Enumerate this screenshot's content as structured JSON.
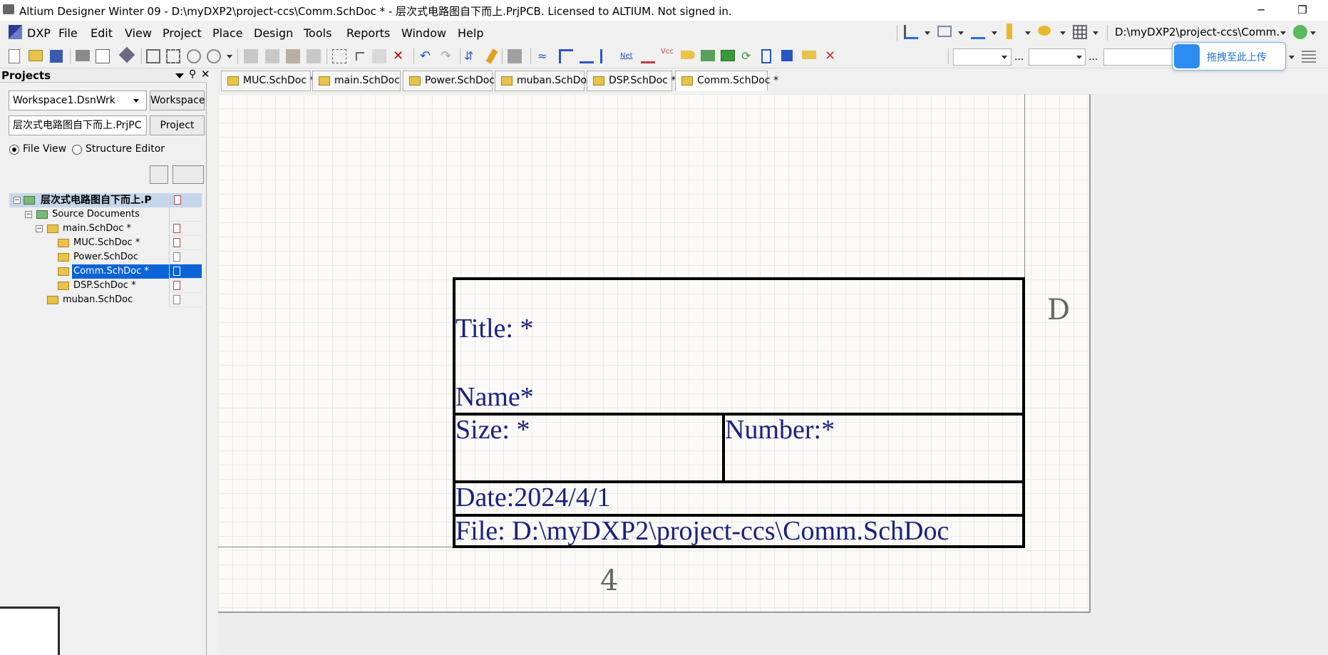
{
  "window": {
    "title": "Altium Designer Winter 09 - D:\\myDXP2\\project-ccs\\Comm.SchDoc * - 层次式电路图自下而上.PrjPCB. Licensed to ALTIUM. Not signed in.",
    "minimize": "─",
    "restore": "❐"
  },
  "menu": {
    "items": [
      "DXP",
      "File",
      "Edit",
      "View",
      "Project",
      "Place",
      "Design",
      "Tools",
      "Reports",
      "Window",
      "Help"
    ]
  },
  "toolbar": {
    "path_combo": "D:\\myDXP2\\project-ccs\\Comm.",
    "ellipsis1": "...",
    "ellipsis2": "...",
    "baidu_label": "拖拽至此上传"
  },
  "panel": {
    "title": "Projects",
    "workspace_combo": "Workspace1.DsnWrk",
    "workspace_button": "Workspace",
    "project_combo": "层次式电路图自下而上.PrjPC",
    "project_button": "Project",
    "radio_file_view": "File View",
    "radio_structure_editor": "Structure Editor",
    "tree": {
      "root": "层次式电路图自下而上.P",
      "source_documents": "Source Documents",
      "items": [
        {
          "label": "main.SchDoc *"
        },
        {
          "label": "MUC.SchDoc *"
        },
        {
          "label": "Power.SchDoc"
        },
        {
          "label": "Comm.SchDoc *"
        },
        {
          "label": "DSP.SchDoc *"
        },
        {
          "label": "muban.SchDoc"
        }
      ]
    }
  },
  "tabs": [
    "MUC.SchDoc *",
    "main.SchDoc *",
    "Power.SchDoc",
    "muban.SchDoc",
    "DSP.SchDoc *",
    "Comm.SchDoc *"
  ],
  "sheet": {
    "zone_right": "D",
    "zone_bottom": "4",
    "title_block": {
      "title": "Title: *",
      "name": "Name*",
      "size": "Size: *",
      "number": "Number:*",
      "date": "Date:2024/4/1",
      "file": "File:  D:\\myDXP2\\project-ccs\\Comm.SchDoc"
    }
  },
  "colors": {
    "title_block_text": "#1a2080",
    "selected_tree_item": "#0a64d8",
    "baidu_accent": "#2d8cf0"
  }
}
